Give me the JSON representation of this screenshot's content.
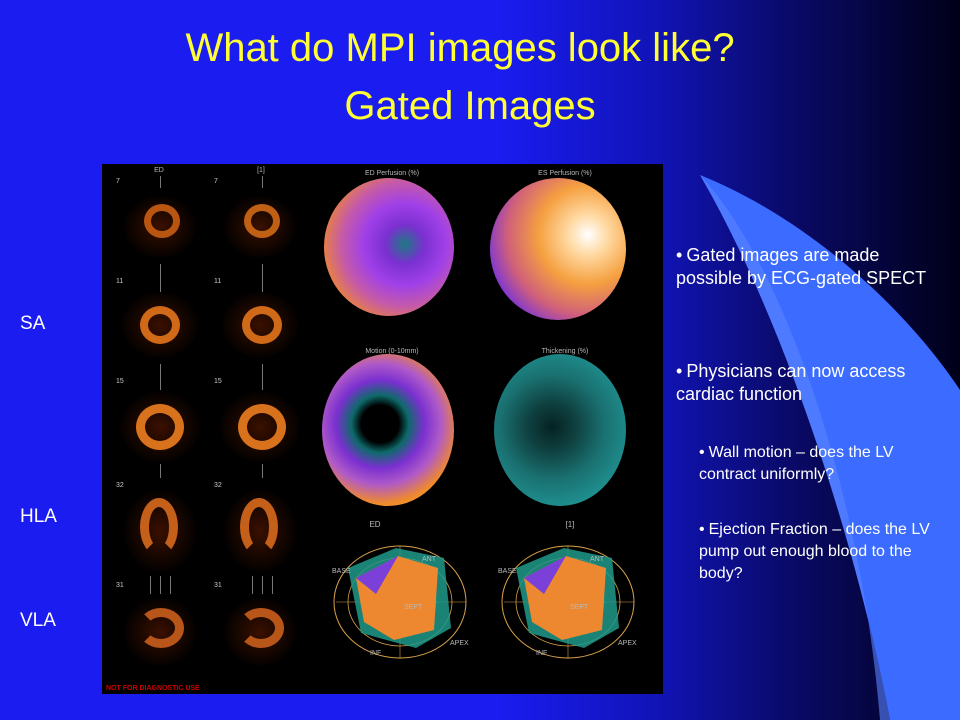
{
  "slide": {
    "title_line1": "What do MPI images look like?",
    "title_line2": "Gated Images",
    "view_labels": {
      "sa": "SA",
      "hla": "HLA",
      "vla": "VLA"
    },
    "panel": {
      "ed_label": "ED",
      "one_label": "[1]",
      "slice_numbers": [
        "7",
        "11",
        "15",
        "32",
        "31"
      ],
      "polar_titles": [
        "ED Perfusion (%)",
        "ES Perfusion (%)",
        "Motion (0-10mm)",
        "Thickening (%)"
      ],
      "model_captions": [
        "ED",
        "[1]"
      ],
      "model_labels": {
        "base": "BASE",
        "ant": "ANT",
        "sept": "SEPT",
        "apex": "APEX",
        "inf": "INF"
      },
      "footer": "NOT FOR DIAGNOSTIC USE"
    },
    "bullets": [
      {
        "bullet": "•",
        "text": "Gated images are made possible by ECG-gated SPECT"
      },
      {
        "bullet": "•",
        "text": "Physicians can now access cardiac function"
      },
      {
        "bullet": "•",
        "text": "Wall motion – does the LV contract uniformly?"
      },
      {
        "bullet": "•",
        "text": "Ejection Fraction – does the LV pump out enough blood to the body?"
      }
    ],
    "colors": {
      "title": "#ffff33",
      "background": "#1a1cf0",
      "swoosh": "#3b6bff"
    }
  }
}
